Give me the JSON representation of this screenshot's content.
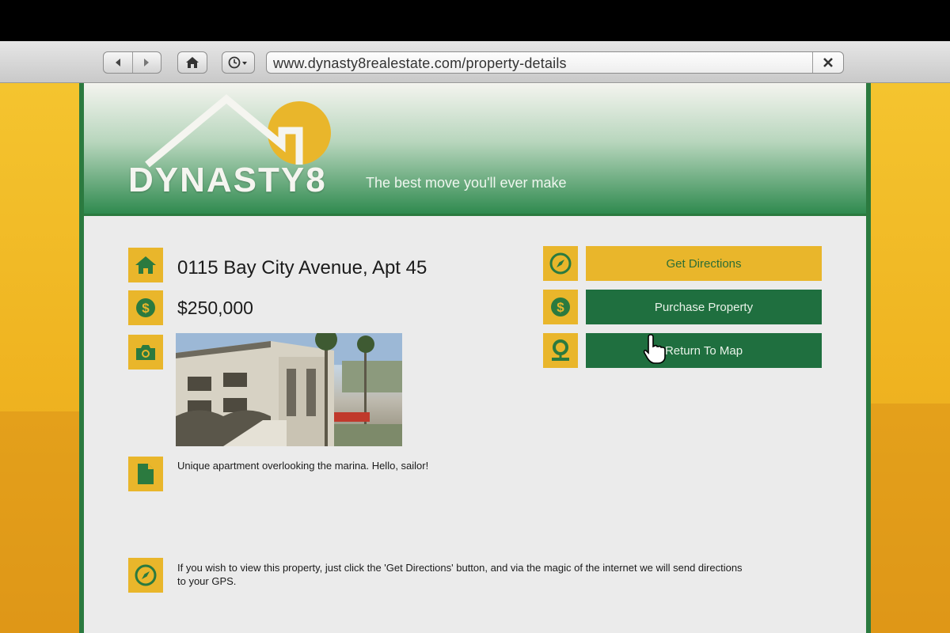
{
  "browser": {
    "url": "www.dynasty8realestate.com/property-details",
    "icons": [
      "back-icon",
      "forward-icon",
      "home-icon",
      "history-icon",
      "close-icon"
    ]
  },
  "site": {
    "logo_text": "DYNASTY8",
    "tagline": "The best move you'll ever make"
  },
  "property": {
    "address": "0115 Bay City Avenue, Apt 45",
    "price": "$250,000",
    "description": "Unique apartment overlooking the marina. Hello, sailor!",
    "info": "If you wish to view this property, just click the 'Get Directions' button, and via the magic of the internet we will send directions to your GPS."
  },
  "actions": {
    "get_directions": "Get Directions",
    "purchase": "Purchase Property",
    "return_map": "Return To Map"
  },
  "colors": {
    "brand_green": "#2b7a3f",
    "button_green": "#1f6f3f",
    "brand_yellow": "#e9b62b",
    "page_bg": "#ebebeb"
  }
}
